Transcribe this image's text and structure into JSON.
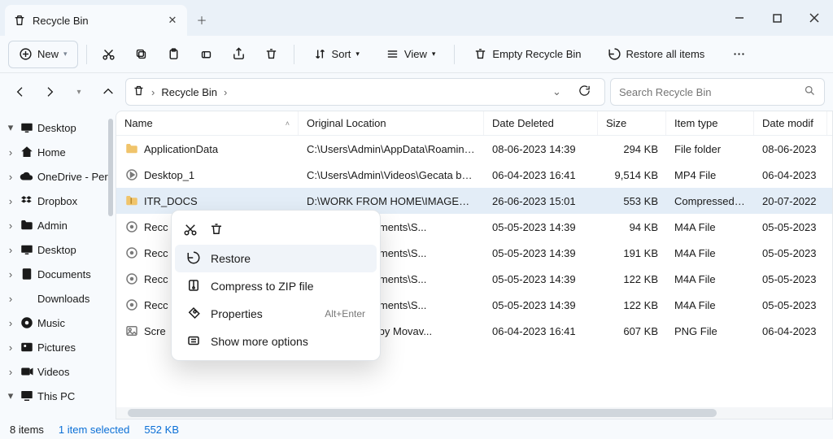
{
  "window": {
    "tab_title": "Recycle Bin"
  },
  "toolbar": {
    "new": "New",
    "sort": "Sort",
    "view": "View",
    "empty": "Empty Recycle Bin",
    "restore_all": "Restore all items"
  },
  "address": {
    "crumbs": [
      "Recycle Bin"
    ],
    "search_placeholder": "Search Recycle Bin"
  },
  "sidebar": [
    {
      "expander": "▾",
      "icon": "desktop",
      "label": "Desktop",
      "color": "#3a8dd4"
    },
    {
      "expander": "›",
      "icon": "home",
      "label": "Home",
      "color": "#e9a94e"
    },
    {
      "expander": "›",
      "icon": "cloud",
      "label": "OneDrive - Per",
      "color": "#1f8ad6"
    },
    {
      "expander": "›",
      "icon": "dropbox",
      "label": "Dropbox",
      "color": "#0a6fd6"
    },
    {
      "expander": "›",
      "icon": "folder",
      "label": "Admin",
      "color": "#f0c46b"
    },
    {
      "expander": "›",
      "icon": "desktop",
      "label": "Desktop",
      "color": "#3a8dd4"
    },
    {
      "expander": "›",
      "icon": "doc",
      "label": "Documents",
      "color": "#7c8998"
    },
    {
      "expander": "›",
      "icon": "download",
      "label": "Downloads",
      "color": "#4bb77a"
    },
    {
      "expander": "›",
      "icon": "music",
      "label": "Music",
      "color": "#d56a4e"
    },
    {
      "expander": "›",
      "icon": "picture",
      "label": "Pictures",
      "color": "#3a8dd4"
    },
    {
      "expander": "›",
      "icon": "video",
      "label": "Videos",
      "color": "#7b61d3"
    },
    {
      "expander": "▾",
      "icon": "pc",
      "label": "This PC",
      "color": "#3a8dd4"
    }
  ],
  "columns": {
    "name": "Name",
    "location": "Original Location",
    "deleted": "Date Deleted",
    "size": "Size",
    "type": "Item type",
    "modified": "Date modif"
  },
  "files": [
    {
      "icon": "folder",
      "name": "ApplicationData",
      "loc": "C:\\Users\\Admin\\AppData\\Roaming\\Luna...",
      "deleted": "08-06-2023 14:39",
      "size": "294 KB",
      "type": "File folder",
      "modified": "08-06-2023"
    },
    {
      "icon": "mp4",
      "name": "Desktop_1",
      "loc": "C:\\Users\\Admin\\Videos\\Gecata by Movavi",
      "deleted": "06-04-2023 16:41",
      "size": "9,514 KB",
      "type": "MP4 File",
      "modified": "06-04-2023"
    },
    {
      "icon": "zip",
      "name": "ITR_DOCS",
      "loc": "D:\\WORK FROM HOME\\IMAGES\\AFR\\sa...",
      "deleted": "26-06-2023 15:01",
      "size": "553 KB",
      "type": "Compressed (zipp...",
      "modified": "20-07-2022",
      "selected": true
    },
    {
      "icon": "m4a",
      "name": "Recc",
      "loc": "OneDrive\\Documents\\S...",
      "deleted": "05-05-2023 14:39",
      "size": "94 KB",
      "type": "M4A File",
      "modified": "05-05-2023"
    },
    {
      "icon": "m4a",
      "name": "Recc",
      "loc": "OneDrive\\Documents\\S...",
      "deleted": "05-05-2023 14:39",
      "size": "191 KB",
      "type": "M4A File",
      "modified": "05-05-2023"
    },
    {
      "icon": "m4a",
      "name": "Recc",
      "loc": "OneDrive\\Documents\\S...",
      "deleted": "05-05-2023 14:39",
      "size": "122 KB",
      "type": "M4A File",
      "modified": "05-05-2023"
    },
    {
      "icon": "m4a",
      "name": "Recc",
      "loc": "OneDrive\\Documents\\S...",
      "deleted": "05-05-2023 14:39",
      "size": "122 KB",
      "type": "M4A File",
      "modified": "05-05-2023"
    },
    {
      "icon": "png",
      "name": "Scre",
      "loc": "Videos\\Gecata by Movav...",
      "deleted": "06-04-2023 16:41",
      "size": "607 KB",
      "type": "PNG File",
      "modified": "06-04-2023"
    }
  ],
  "context": {
    "restore": "Restore",
    "compress": "Compress to ZIP file",
    "properties": "Properties",
    "properties_shortcut": "Alt+Enter",
    "show_more": "Show more options"
  },
  "status": {
    "count": "8 items",
    "selection": "1 item selected",
    "size": "552 KB"
  },
  "colors": {
    "accent": "#0a6fd6",
    "tab_bg": "#eaf1f8"
  }
}
